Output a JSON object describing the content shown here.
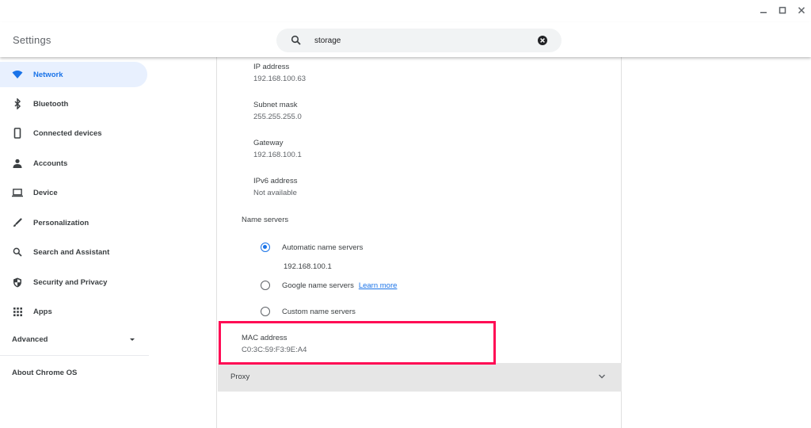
{
  "window": {
    "controls": {
      "minimize": "minimize-icon",
      "maximize": "maximize-icon",
      "close": "close-icon"
    }
  },
  "header": {
    "title": "Settings",
    "search": {
      "value": "storage",
      "icon": "search-icon",
      "clear_icon": "clear-icon"
    }
  },
  "sidebar": {
    "items": [
      {
        "label": "Network",
        "icon": "wifi-icon",
        "active": true
      },
      {
        "label": "Bluetooth",
        "icon": "bluetooth-icon"
      },
      {
        "label": "Connected devices",
        "icon": "phone-icon"
      },
      {
        "label": "Accounts",
        "icon": "person-icon"
      },
      {
        "label": "Device",
        "icon": "laptop-icon"
      },
      {
        "label": "Personalization",
        "icon": "brush-icon"
      },
      {
        "label": "Search and Assistant",
        "icon": "search-icon"
      },
      {
        "label": "Security and Privacy",
        "icon": "shield-icon"
      },
      {
        "label": "Apps",
        "icon": "apps-grid-icon"
      }
    ],
    "advanced": "Advanced",
    "about": "About Chrome OS"
  },
  "network": {
    "fields": [
      {
        "label": "IP address",
        "value": "192.168.100.63"
      },
      {
        "label": "Subnet mask",
        "value": "255.255.255.0"
      },
      {
        "label": "Gateway",
        "value": "192.168.100.1"
      },
      {
        "label": "IPv6 address",
        "value": "Not available"
      }
    ],
    "name_servers": {
      "label": "Name servers",
      "options": [
        {
          "label": "Automatic name servers",
          "checked": true,
          "detail": "192.168.100.1"
        },
        {
          "label": "Google name servers",
          "checked": false,
          "link": "Learn more"
        },
        {
          "label": "Custom name servers",
          "checked": false
        }
      ]
    },
    "mac": {
      "label": "MAC address",
      "value": "C0:3C:59:F3:9E:A4"
    },
    "proxy": {
      "label": "Proxy"
    }
  },
  "colors": {
    "accent": "#1a73e8",
    "active_bg": "#e8f0fe",
    "highlight": "#ff0a54",
    "proxy_bg": "#e6e6e6"
  }
}
